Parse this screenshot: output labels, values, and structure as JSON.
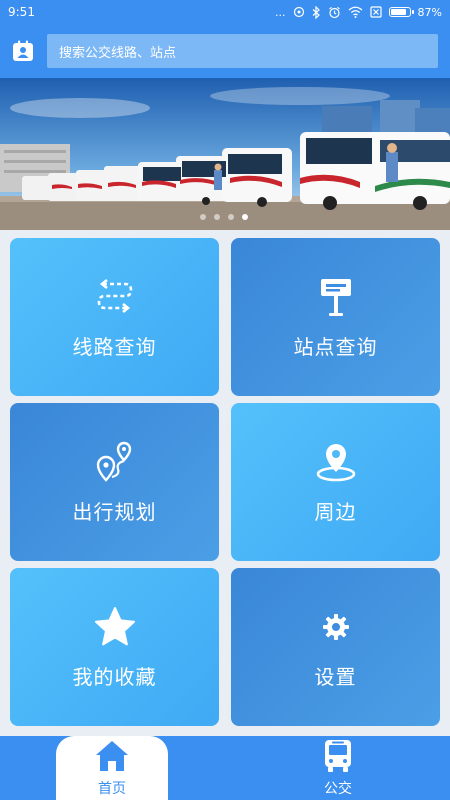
{
  "status": {
    "time": "9:51",
    "dots": "...",
    "battery": "87%"
  },
  "search": {
    "placeholder": "搜索公交线路、站点"
  },
  "banner": {
    "total_dots": 4,
    "active_dot": 4
  },
  "tiles": [
    {
      "label": "线路查询",
      "icon": "route-icon"
    },
    {
      "label": "站点查询",
      "icon": "bus-stop-sign-icon"
    },
    {
      "label": "出行规划",
      "icon": "map-pin-route-icon"
    },
    {
      "label": "周边",
      "icon": "location-pin-icon"
    },
    {
      "label": "我的收藏",
      "icon": "star-icon"
    },
    {
      "label": "设置",
      "icon": "gear-icon"
    }
  ],
  "tabs": [
    {
      "label": "首页",
      "icon": "home-icon",
      "active": true
    },
    {
      "label": "公交",
      "icon": "bus-icon",
      "active": false
    }
  ],
  "colors": {
    "primary": "#3b8ff0",
    "tile_light": "#4fb8f8",
    "tile_dark": "#3d8ee0"
  }
}
